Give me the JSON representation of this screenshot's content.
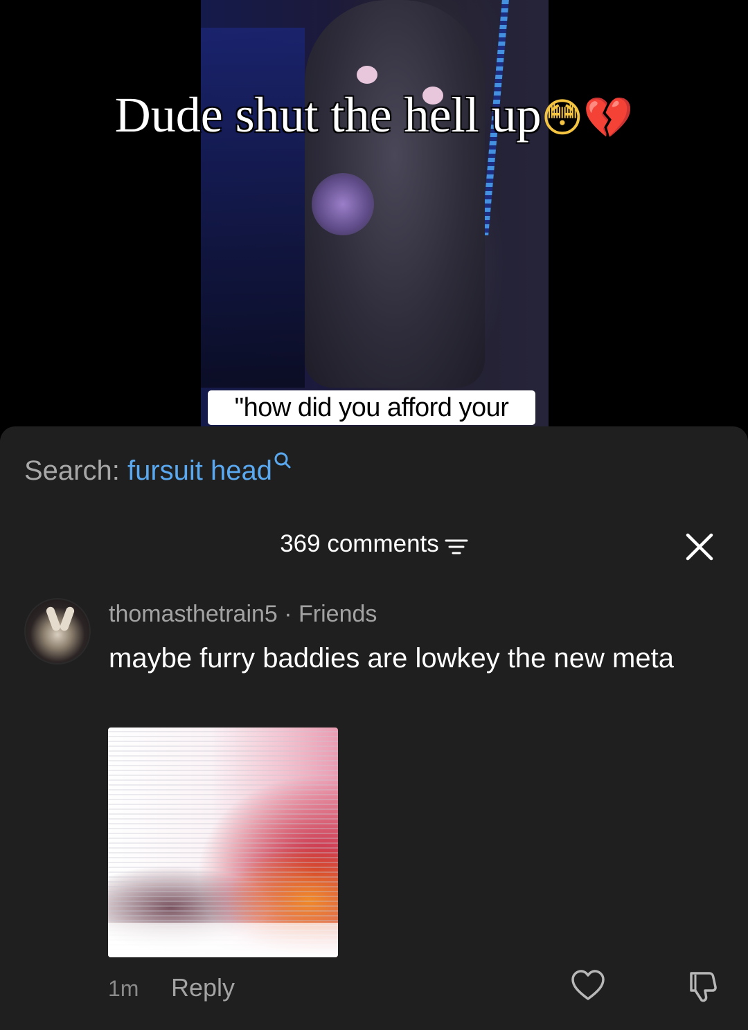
{
  "video": {
    "overlay_title": "Dude shut the hell up",
    "overlay_emoji_1": "😳",
    "overlay_emoji_2": "💔",
    "caption": "\"how did you afford your"
  },
  "search": {
    "label": "Search:",
    "term": "fursuit head"
  },
  "comments_panel": {
    "count_label": "369 comments"
  },
  "comment": {
    "username": "thomasthetrain5",
    "separator": " · ",
    "relation": "Friends",
    "text": "maybe furry baddies are lowkey the new meta",
    "time": "1m",
    "reply_label": "Reply"
  },
  "colors": {
    "sheet_bg": "#1f1f1f",
    "search_accent": "#5aa9f0",
    "secondary_text": "#a3a3a3"
  },
  "icons": [
    "search-icon",
    "sort-icon",
    "close-icon",
    "heart-icon",
    "dislike-icon"
  ]
}
